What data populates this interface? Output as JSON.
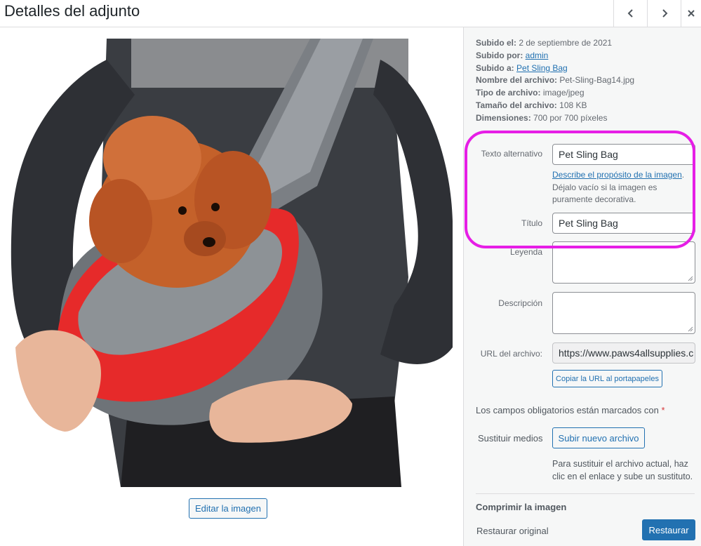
{
  "header": {
    "title": "Detalles del adjunto"
  },
  "metadata": {
    "uploaded_on_label": "Subido el:",
    "uploaded_on_value": "2 de septiembre de 2021",
    "uploaded_by_label": "Subido por:",
    "uploaded_by_value": "admin",
    "uploaded_to_label": "Subido a:",
    "uploaded_to_value": "Pet Sling Bag",
    "filename_label": "Nombre del archivo:",
    "filename_value": "Pet-Sling-Bag14.jpg",
    "filetype_label": "Tipo de archivo:",
    "filetype_value": "image/jpeg",
    "filesize_label": "Tamaño del archivo:",
    "filesize_value": "108 KB",
    "dimensions_label": "Dimensiones:",
    "dimensions_value": "700 por 700 píxeles"
  },
  "fields": {
    "alt_label": "Texto alternativo",
    "alt_value": "Pet Sling Bag",
    "alt_help_link": "Describe el propósito de la imagen",
    "alt_help_after_link": ".",
    "alt_help_text": "Déjalo vacío si la imagen es puramente decorativa.",
    "title_label": "Título",
    "title_value": "Pet Sling Bag",
    "caption_label": "Leyenda",
    "description_label": "Descripción",
    "url_label": "URL del archivo:",
    "url_value": "https://www.paws4allsupplies.c",
    "copy_url_button": "Copiar la URL al portapapeles"
  },
  "required_note": {
    "text": "Los campos obligatorios están marcados con",
    "star": "*"
  },
  "replace": {
    "label": "Sustituir medios",
    "button": "Subir nuevo archivo",
    "help": "Para sustituir el archivo actual, haz clic en el enlace y sube un sustituto."
  },
  "compress": {
    "heading": "Comprimir la imagen",
    "restore_label": "Restaurar original",
    "restore_button": "Restaurar"
  },
  "media": {
    "edit_button": "Editar la imagen"
  },
  "colors": {
    "accent": "#2271b1",
    "highlight": "#e61ee6"
  }
}
